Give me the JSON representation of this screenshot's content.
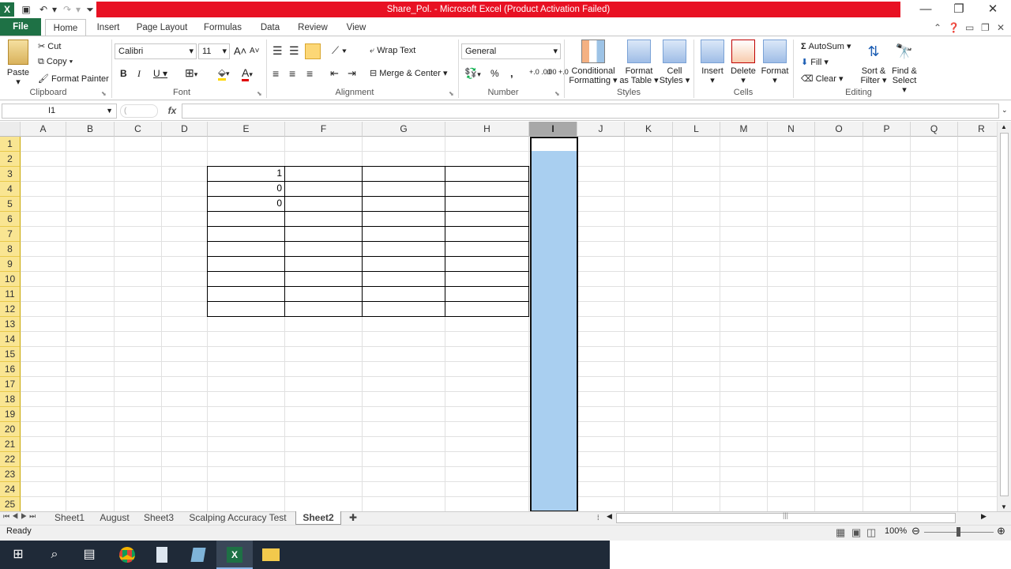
{
  "title_bar": {
    "title": "Share_Pol. - Microsoft Excel (Product Activation Failed)"
  },
  "tabs": [
    "File",
    "Home",
    "Insert",
    "Page Layout",
    "Formulas",
    "Data",
    "Review",
    "View"
  ],
  "ribbon": {
    "clipboard": {
      "paste": "Paste",
      "cut": "Cut",
      "copy": "Copy",
      "format_painter": "Format Painter",
      "label": "Clipboard"
    },
    "font": {
      "name": "Calibri",
      "size": "11",
      "label": "Font",
      "bold": "B",
      "italic": "I",
      "underline": "U",
      "grow": "A",
      "shrink": "A",
      "font_color": "A"
    },
    "alignment": {
      "wrap": "Wrap Text",
      "merge": "Merge & Center",
      "label": "Alignment"
    },
    "number": {
      "format": "General",
      "label": "Number",
      "percent": "%",
      "comma": ",",
      "inc_dec": "+.0 .00",
      "dec_dec": ".00 +.0"
    },
    "styles": {
      "conditional": "Conditional",
      "conditional2": "Formatting",
      "format_table": "Format",
      "format_table2": "as Table",
      "cell_styles": "Cell",
      "cell_styles2": "Styles",
      "label": "Styles"
    },
    "cells": {
      "insert": "Insert",
      "delete": "Delete",
      "format": "Format",
      "label": "Cells"
    },
    "editing": {
      "autosum": "AutoSum",
      "fill": "Fill",
      "clear": "Clear",
      "sort": "Sort &",
      "sort2": "Filter",
      "find": "Find &",
      "find2": "Select",
      "label": "Editing"
    }
  },
  "formula_bar": {
    "name_box": "I1",
    "fx": "fx",
    "content": ""
  },
  "columns": [
    "A",
    "B",
    "C",
    "D",
    "E",
    "F",
    "G",
    "H",
    "I",
    "J",
    "K",
    "L",
    "M",
    "N",
    "O",
    "P",
    "Q",
    "R"
  ],
  "rows": [
    "1",
    "2",
    "3",
    "4",
    "5",
    "6",
    "7",
    "8",
    "9",
    "10",
    "11",
    "12",
    "13",
    "14",
    "15",
    "16",
    "17",
    "18",
    "19",
    "20",
    "21",
    "22",
    "23",
    "24",
    "25"
  ],
  "cells": {
    "E3": "1",
    "E4": "0",
    "E5": "0"
  },
  "sheets": [
    "Sheet1",
    "August",
    "Sheet3",
    "Scalping Accuracy Test",
    "Sheet2"
  ],
  "active_sheet": "Sheet2",
  "status": {
    "ready": "Ready",
    "zoom": "100%"
  },
  "colors": {
    "excel_green": "#1e7145",
    "title_red": "#e81123",
    "selection": "#a9cff0",
    "row_header_highlight": "#f9e592"
  }
}
